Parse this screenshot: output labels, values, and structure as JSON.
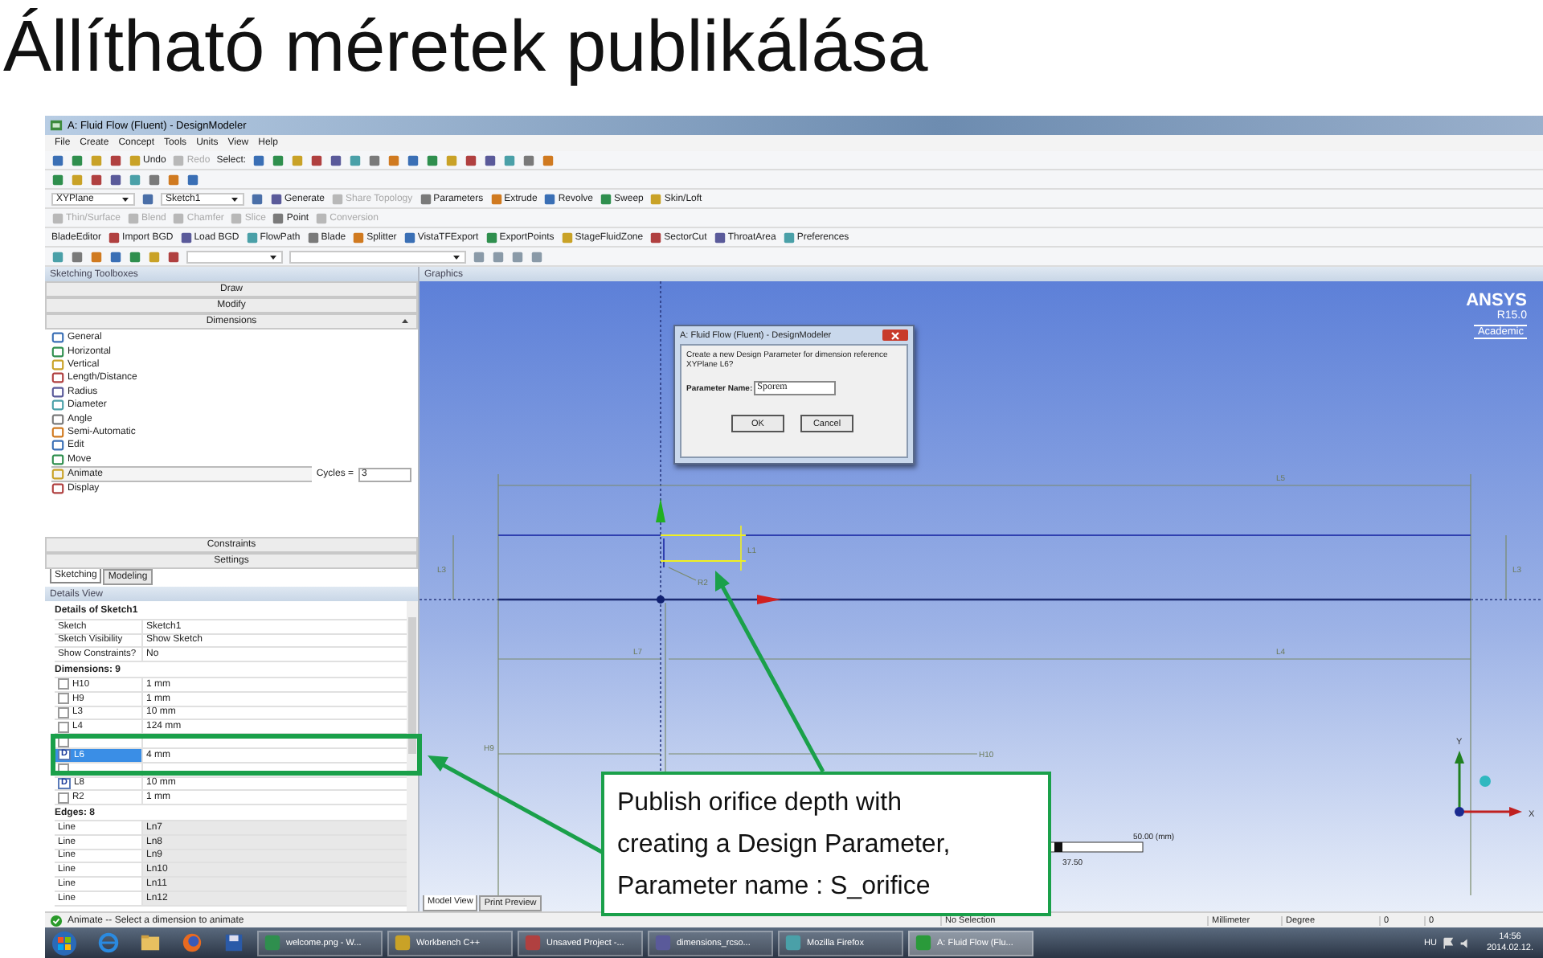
{
  "slide_title": "Állítható méretek publikálása",
  "app": {
    "title": "A: Fluid Flow (Fluent) - DesignModeler",
    "menu": [
      "File",
      "Create",
      "Concept",
      "Tools",
      "Units",
      "View",
      "Help"
    ],
    "toolbar_rows": [
      {
        "items": [
          {
            "kind": "button",
            "label": "Undo",
            "disabled": false
          },
          {
            "kind": "button",
            "label": "Redo",
            "disabled": true
          },
          {
            "kind": "label",
            "label": "Select:",
            "disabled": false
          }
        ]
      },
      {
        "items": []
      },
      {
        "items": [
          {
            "kind": "dropdown",
            "label": "XYPlane"
          },
          {
            "kind": "dropdown",
            "label": "Sketch1"
          },
          {
            "kind": "button",
            "label": "Generate",
            "disabled": false
          },
          {
            "kind": "button",
            "label": "Share Topology",
            "disabled": true
          },
          {
            "kind": "button",
            "label": "Parameters",
            "disabled": false
          },
          {
            "kind": "button",
            "label": "Extrude",
            "disabled": false
          },
          {
            "kind": "button",
            "label": "Revolve",
            "disabled": false
          },
          {
            "kind": "button",
            "label": "Sweep",
            "disabled": false
          },
          {
            "kind": "button",
            "label": "Skin/Loft",
            "disabled": false
          }
        ]
      },
      {
        "items": [
          {
            "kind": "button",
            "label": "Thin/Surface",
            "disabled": true
          },
          {
            "kind": "button",
            "label": "Blend",
            "disabled": true
          },
          {
            "kind": "button",
            "label": "Chamfer",
            "disabled": true
          },
          {
            "kind": "button",
            "label": "Slice",
            "disabled": true
          },
          {
            "kind": "button",
            "label": "Point",
            "disabled": false
          },
          {
            "kind": "button",
            "label": "Conversion",
            "disabled": true
          }
        ]
      },
      {
        "items": [
          {
            "kind": "label",
            "label": "BladeEditor",
            "disabled": false
          },
          {
            "kind": "button",
            "label": "Import BGD",
            "disabled": false
          },
          {
            "kind": "button",
            "label": "Load BGD",
            "disabled": false
          },
          {
            "kind": "button",
            "label": "FlowPath",
            "disabled": false
          },
          {
            "kind": "button",
            "label": "Blade",
            "disabled": false
          },
          {
            "kind": "button",
            "label": "Splitter",
            "disabled": false
          },
          {
            "kind": "button",
            "label": "VistaTFExport",
            "disabled": false
          },
          {
            "kind": "button",
            "label": "ExportPoints",
            "disabled": false
          },
          {
            "kind": "button",
            "label": "StageFluidZone",
            "disabled": false
          },
          {
            "kind": "button",
            "label": "SectorCut",
            "disabled": false
          },
          {
            "kind": "button",
            "label": "ThroatArea",
            "disabled": false
          },
          {
            "kind": "button",
            "label": "Preferences",
            "disabled": false
          }
        ]
      },
      {
        "items": []
      }
    ],
    "toolbox": {
      "title": "Sketching Toolboxes",
      "sections": [
        {
          "label": "Draw",
          "expanded": false
        },
        {
          "label": "Modify",
          "expanded": false
        },
        {
          "label": "Dimensions",
          "expanded": true
        }
      ],
      "tools": [
        {
          "label": "General",
          "selected": false
        },
        {
          "label": "Horizontal",
          "selected": false
        },
        {
          "label": "Vertical",
          "selected": false
        },
        {
          "label": "Length/Distance",
          "selected": false
        },
        {
          "label": "Radius",
          "selected": false
        },
        {
          "label": "Diameter",
          "selected": false
        },
        {
          "label": "Angle",
          "selected": false
        },
        {
          "label": "Semi-Automatic",
          "selected": false
        },
        {
          "label": "Edit",
          "selected": false
        },
        {
          "label": "Move",
          "selected": false
        },
        {
          "label": "Animate",
          "selected": true,
          "option_label": "Cycles =",
          "option_value": "3"
        },
        {
          "label": "Display",
          "selected": false
        }
      ],
      "bottom_sections": [
        "Constraints",
        "Settings"
      ],
      "tabs": [
        {
          "label": "Sketching",
          "selected": true
        },
        {
          "label": "Modeling",
          "selected": false
        }
      ]
    },
    "details": {
      "title": "Details View",
      "groups": [
        {
          "title": "Details of Sketch1",
          "rows": [
            {
              "name": "Sketch",
              "value": "Sketch1",
              "selected": false
            },
            {
              "name": "Sketch Visibility",
              "value": "Show Sketch",
              "selected": false
            },
            {
              "name": "Show Constraints?",
              "value": "No",
              "selected": false
            }
          ]
        },
        {
          "title": "Dimensions: 9",
          "rows": [
            {
              "kind": "dimension",
              "name": "H10",
              "value": "1 mm",
              "selected": false
            },
            {
              "kind": "dimension",
              "name": "H9",
              "value": "1 mm",
              "selected": false
            },
            {
              "kind": "dimension",
              "name": "L3",
              "value": "10 mm",
              "selected": false
            },
            {
              "kind": "dimension",
              "name": "L4",
              "value": "124 mm",
              "selected": false
            },
            {
              "kind": "dimension",
              "selected": false
            },
            {
              "kind": "dimension",
              "name": "L6",
              "value": "4 mm",
              "badge": "D",
              "selected": true
            },
            {
              "kind": "dimension",
              "selected": false
            },
            {
              "kind": "dimension",
              "name": "L8",
              "value": "10 mm",
              "badge": "D",
              "selected": false
            },
            {
              "kind": "dimension",
              "name": "R2",
              "value": "1 mm",
              "selected": false
            }
          ]
        },
        {
          "title": "Edges: 8",
          "rows": [
            {
              "name": "Line",
              "value": "Ln7",
              "selected": false
            },
            {
              "name": "Line",
              "value": "Ln8",
              "selected": false
            },
            {
              "name": "Line",
              "value": "Ln9",
              "selected": false
            },
            {
              "name": "Line",
              "value": "Ln10",
              "selected": false
            },
            {
              "name": "Line",
              "value": "Ln11",
              "selected": false
            },
            {
              "name": "Line",
              "value": "Ln12",
              "selected": false
            }
          ]
        }
      ]
    },
    "graphics": {
      "title": "Graphics",
      "logo": {
        "name": "ANSYS",
        "version": "R15.0",
        "edition": "Academic"
      },
      "dimension_labels": [
        "L5",
        "L3",
        "L1",
        "R2",
        "L3",
        "L7",
        "L4",
        "H9",
        "H10"
      ],
      "axis_labels": [
        "Y",
        "X"
      ],
      "scale": {
        "end_label": "50.00 (mm)",
        "mid_label": "37.50"
      },
      "tabs": [
        {
          "label": "Model View",
          "selected": true
        },
        {
          "label": "Print Preview",
          "selected": false
        }
      ],
      "dialog": {
        "title": "A: Fluid Flow (Fluent) - DesignModeler",
        "message": "Create a new Design Parameter for dimension reference XYPlane L6?",
        "field_label": "Parameter Name:",
        "field_value": "Sporem",
        "buttons": [
          "OK",
          "Cancel"
        ]
      }
    },
    "status_bar": {
      "message": "Animate -- Select a dimension to animate",
      "selection": "No Selection",
      "unit": "Millimeter",
      "angle_unit": "Degree",
      "values": [
        "0",
        "0"
      ]
    }
  },
  "taskbar": {
    "tasks": [
      {
        "label": "welcome.png - W...",
        "selected": false
      },
      {
        "label": "Workbench C++",
        "selected": false
      },
      {
        "label": "Unsaved Project -...",
        "selected": false
      },
      {
        "label": "dimensions_rcso...",
        "selected": false
      },
      {
        "label": "Mozilla Firefox",
        "selected": false
      },
      {
        "label": "A: Fluid Flow (Flu...",
        "selected": true
      }
    ],
    "language": "HU",
    "time": "14:56",
    "date": "2014.02.12."
  },
  "callout": {
    "text": "Publish orifice depth with creating a Design Parameter, Parameter name : S_orifice"
  }
}
